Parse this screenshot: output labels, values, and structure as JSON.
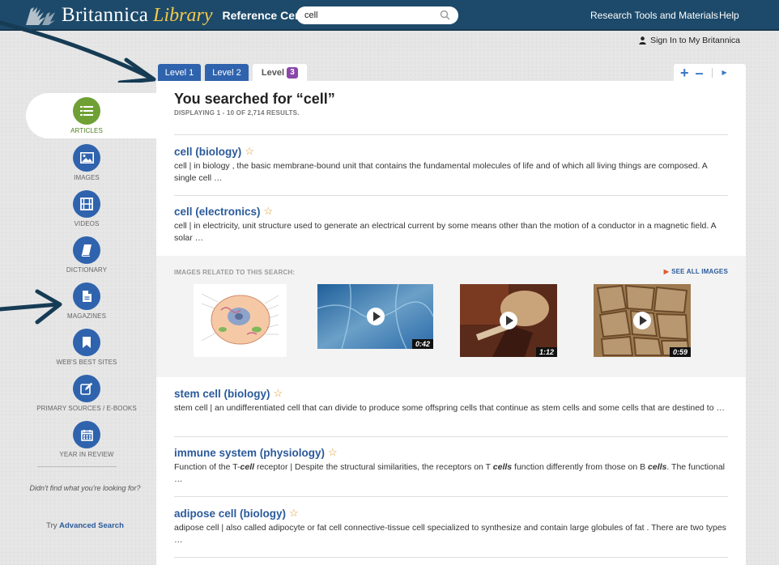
{
  "header": {
    "logo_britannica": "Britannica",
    "logo_library": "Library",
    "logo_reference": "Reference Center",
    "search_value": "cell",
    "nav_research": "Research Tools and Materials",
    "nav_help": "Help"
  },
  "signin": "Sign In to My Britannica",
  "tabs": [
    {
      "label": "Level 1"
    },
    {
      "label": "Level 2"
    },
    {
      "label": "Level",
      "badge": "3"
    }
  ],
  "results_header": {
    "title": "You searched for “cell”",
    "subtitle": "DISPLAYING 1 - 10 OF 2,714 RESULTS."
  },
  "results": [
    {
      "title": "cell (biology)",
      "snippet": "cell  |  in biology , the basic membrane-bound unit that contains the fundamental molecules of life and of which all living things are composed. A single cell …"
    },
    {
      "title": "cell (electronics)",
      "snippet": "cell  |  in electricity, unit structure used to generate an electrical current by some means other than the motion of a conductor in a magnetic field. A solar …"
    },
    {
      "title": "stem cell (biology)",
      "snippet": "stem cell  |  an undifferentiated cell that can divide to produce some offspring cells that continue as stem cells and some cells that are destined to …"
    },
    {
      "title": "immune system (physiology)",
      "snippet_parts": [
        "Function of the T-",
        "cell",
        " receptor  | Despite the structural similarities, the receptors on T ",
        "cells",
        " function differently from those on B ",
        "cells",
        ". The functional …"
      ]
    },
    {
      "title": "adipose cell (biology)",
      "snippet": "adipose cell  |  also called adipocyte or fat cell  connective-tissue cell specialized to synthesize and contain large globules of fat . There are two types …"
    }
  ],
  "related": {
    "label": "IMAGES RELATED TO THIS SEARCH:",
    "see_all": "SEE ALL IMAGES",
    "durations": [
      "0:42",
      "1:12",
      "0:59"
    ]
  },
  "sidebar": {
    "items": [
      {
        "label": "ARTICLES",
        "icon": "list-icon"
      },
      {
        "label": "IMAGES",
        "icon": "image-icon"
      },
      {
        "label": "VIDEOS",
        "icon": "film-icon"
      },
      {
        "label": "DICTIONARY",
        "icon": "book-icon"
      },
      {
        "label": "MAGAZINES",
        "icon": "document-icon"
      },
      {
        "label": "WEB'S BEST SITES",
        "icon": "bookmark-icon"
      },
      {
        "label": "PRIMARY SOURCES / E-BOOKS",
        "icon": "edit-icon"
      },
      {
        "label": "YEAR IN REVIEW",
        "icon": "calendar-icon"
      }
    ],
    "help_text": "Didn't find what you're looking for?",
    "try_prefix": "Try ",
    "try_link": "Advanced Search"
  },
  "colors": {
    "header_bg": "#1d4a6a",
    "accent_blue": "#2f63ad",
    "link_blue": "#2b5a9b",
    "articles_green": "#6fa034",
    "level_badge": "#8a46a8",
    "star": "#e09a2a"
  }
}
